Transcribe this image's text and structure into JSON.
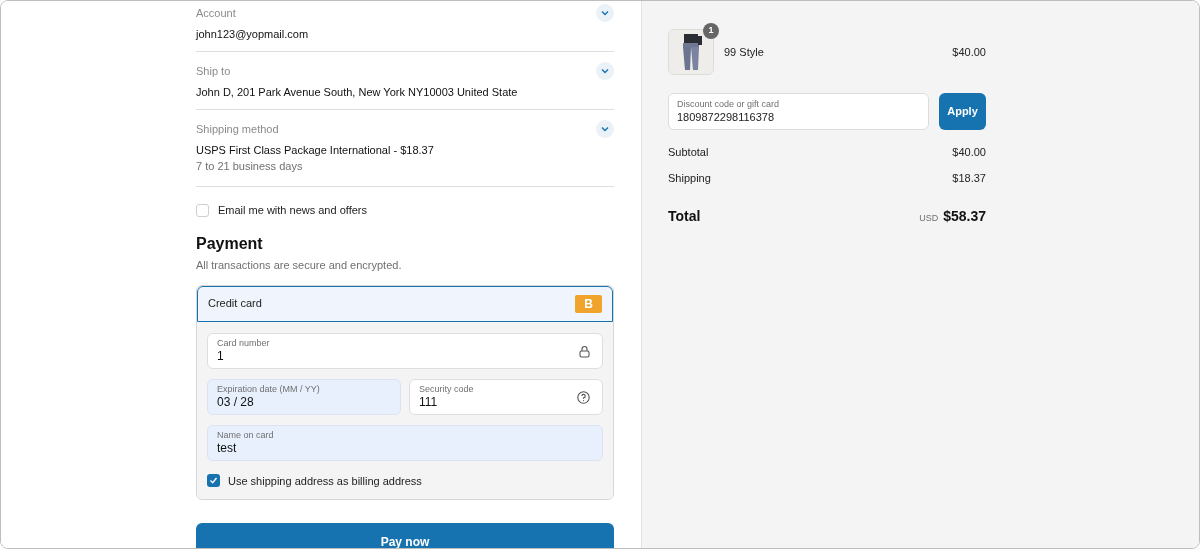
{
  "review": [
    {
      "label": "Account",
      "value": "john123@yopmail.com",
      "expanded": false
    },
    {
      "label": "Ship to",
      "value": "John D, 201 Park Avenue South, New York NY10003 United State",
      "expanded": false
    },
    {
      "label": "Shipping method",
      "value": "USPS First Class Package International - $18.37",
      "detail": "7 to 21 business days",
      "expanded": false
    }
  ],
  "newsletter": {
    "label": "Email me with news and offers",
    "checked": false
  },
  "payment": {
    "title": "Payment",
    "subtitle": "All transactions are secure and encrypted.",
    "method": {
      "label": "Credit card",
      "badge": "B",
      "selected": true
    },
    "fields": [
      {
        "label": "Card number",
        "value": "1",
        "kind": "secure",
        "autofilled": false
      },
      {
        "label": "Expiration date (MM / YY)",
        "value": "03 / 28",
        "kind": "plain",
        "autofilled": true
      },
      {
        "label": "Security code",
        "value": "111",
        "kind": "help",
        "autofilled": false
      },
      {
        "label": "Name on card",
        "value": "test",
        "kind": "plain",
        "autofilled": true
      }
    ],
    "billing": {
      "label": "Use shipping address as billing address",
      "checked": true
    }
  },
  "pay_button": "Pay now",
  "summary": {
    "item": {
      "quantity": "1",
      "name": "99 Style",
      "price": "$40.00",
      "kind": "picture"
    },
    "discount": {
      "placeholder": "Discount code or gift card",
      "value": "1809872298116378",
      "button": "Apply"
    },
    "lines": [
      {
        "label": "Subtotal",
        "value": "$40.00"
      },
      {
        "label": "Shipping",
        "value": "$18.37"
      }
    ],
    "total": {
      "label": "Total",
      "currency": "USD",
      "value": "$58.37"
    }
  }
}
